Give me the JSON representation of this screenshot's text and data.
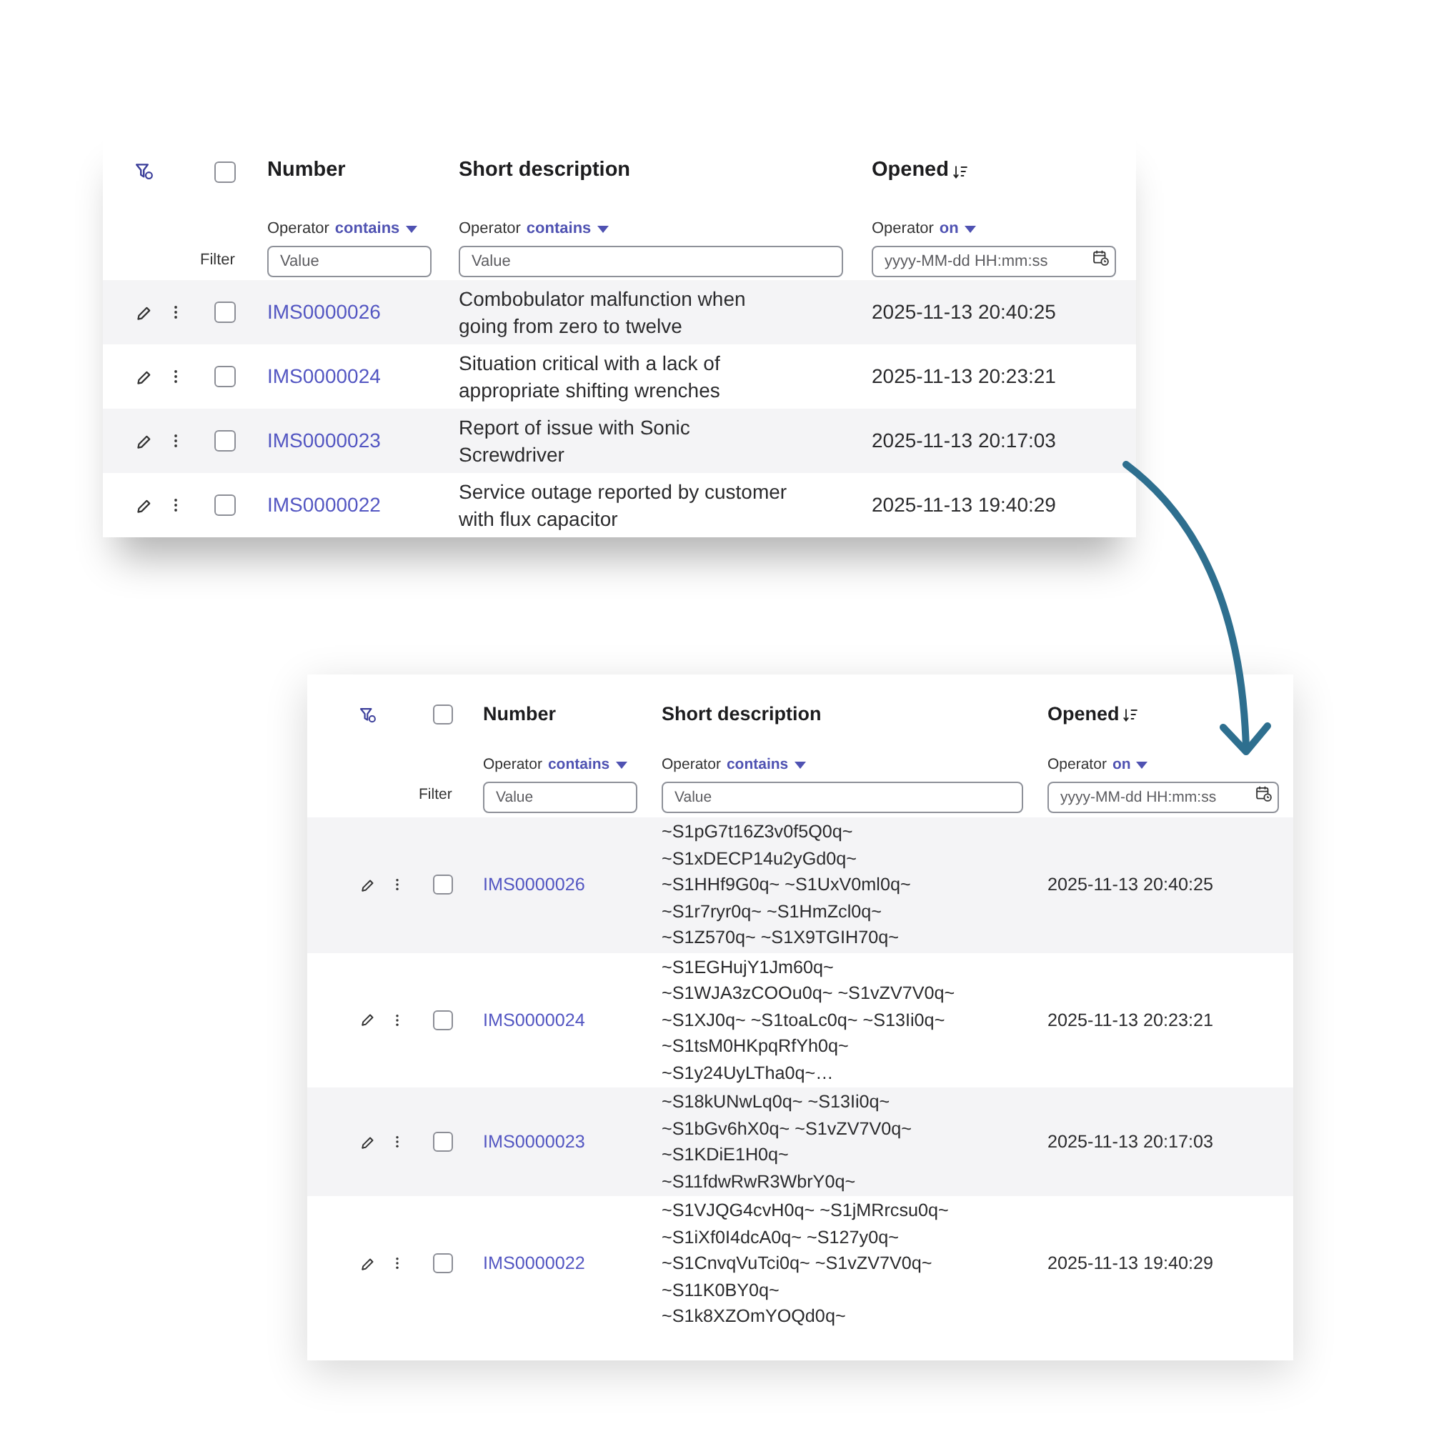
{
  "tables": [
    {
      "select_all_checked": false,
      "filter_label": "Filter",
      "columns": [
        {
          "label": "Number",
          "sorted": false,
          "operator_label": "Operator",
          "operator": "contains",
          "placeholder": "Value",
          "kind": "link"
        },
        {
          "label": "Short description",
          "sorted": false,
          "operator_label": "Operator",
          "operator": "contains",
          "placeholder": "Value",
          "kind": "text"
        },
        {
          "label": "Opened",
          "sorted": true,
          "operator_label": "Operator",
          "operator": "on",
          "placeholder": "yyyy-MM-dd HH:mm:ss",
          "kind": "date"
        }
      ],
      "rows": [
        {
          "checked": false,
          "cells": [
            "IMS0000026",
            "Combobulator malfunction when\ngoing from zero to twelve",
            "2025-11-13 20:40:25"
          ]
        },
        {
          "checked": false,
          "cells": [
            "IMS0000024",
            "Situation critical with a lack of\nappropriate shifting wrenches",
            "2025-11-13 20:23:21"
          ]
        },
        {
          "checked": false,
          "cells": [
            "IMS0000023",
            "Report of issue with Sonic\nScrewdriver",
            "2025-11-13 20:17:03"
          ]
        },
        {
          "checked": false,
          "cells": [
            "IMS0000022",
            "Service outage reported by customer\nwith flux capacitor",
            "2025-11-13 19:40:29"
          ]
        }
      ]
    },
    {
      "select_all_checked": false,
      "filter_label": "Filter",
      "columns": [
        {
          "label": "Number",
          "sorted": false,
          "operator_label": "Operator",
          "operator": "contains",
          "placeholder": "Value",
          "kind": "link"
        },
        {
          "label": "Short description",
          "sorted": false,
          "operator_label": "Operator",
          "operator": "contains",
          "placeholder": "Value",
          "kind": "text"
        },
        {
          "label": "Opened",
          "sorted": true,
          "operator_label": "Operator",
          "operator": "on",
          "placeholder": "yyyy-MM-dd HH:mm:ss",
          "kind": "date"
        }
      ],
      "rows": [
        {
          "checked": false,
          "cells": [
            "IMS0000026",
            "~S1pG7t16Z3v0f5Q0q~\n~S1xDECP14u2yGd0q~\n~S1HHf9G0q~ ~S1UxV0ml0q~\n~S1r7ryr0q~ ~S1HmZcl0q~\n~S1Z570q~ ~S1X9TGIH70q~",
            "2025-11-13 20:40:25"
          ]
        },
        {
          "checked": false,
          "cells": [
            "IMS0000024",
            "~S1EGHujY1Jm60q~\n~S1WJA3zCOOu0q~ ~S1vZV7V0q~\n~S1XJ0q~ ~S1toaLc0q~ ~S13Ii0q~\n~S1tsM0HKpqRfYh0q~\n~S1y24UyLTha0q~…",
            "2025-11-13 20:23:21"
          ]
        },
        {
          "checked": false,
          "cells": [
            "IMS0000023",
            "~S18kUNwLq0q~ ~S13Ii0q~\n~S1bGv6hX0q~ ~S1vZV7V0q~\n~S1KDiE1H0q~\n~S11fdwRwR3WbrY0q~",
            "2025-11-13 20:17:03"
          ]
        },
        {
          "checked": false,
          "cells": [
            "IMS0000022",
            "~S1VJQG4cvH0q~ ~S1jMRrcsu0q~\n~S1iXf0I4dcA0q~ ~S127y0q~\n~S1CnvqVuTci0q~ ~S1vZV7V0q~\n~S11K0BY0q~\n~S1k8XZOmYOQd0q~",
            "2025-11-13 19:40:29"
          ]
        }
      ]
    }
  ]
}
